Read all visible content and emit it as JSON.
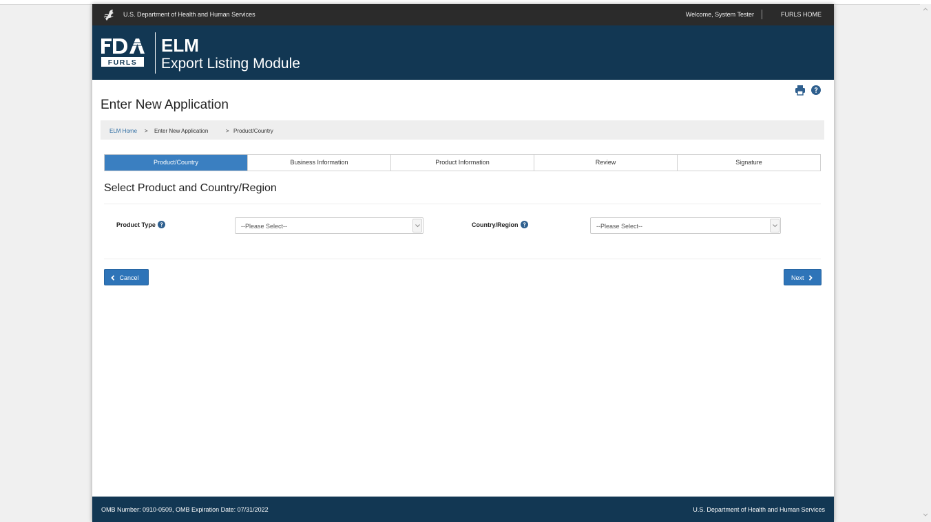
{
  "utility_bar": {
    "department": "U.S. Department of Health and Human Services",
    "welcome": "Welcome, System Tester",
    "home_link": "FURLS HOME"
  },
  "header": {
    "logo_text": "FURLS",
    "app_short": "ELM",
    "app_long": "Export Listing Module"
  },
  "page": {
    "title": "Enter New Application"
  },
  "breadcrumb": {
    "items": [
      "ELM Home",
      "Enter New Application",
      "Product/Country"
    ],
    "separator": ">"
  },
  "steps": [
    {
      "label": "Product/Country",
      "active": true
    },
    {
      "label": "Business Information",
      "active": false
    },
    {
      "label": "Product Information",
      "active": false
    },
    {
      "label": "Review",
      "active": false
    },
    {
      "label": "Signature",
      "active": false
    }
  ],
  "form": {
    "section_title": "Select Product and Country/Region",
    "product_type": {
      "label": "Product Type",
      "value": "--Please Select--"
    },
    "country_region": {
      "label": "Country/Region",
      "value": "--Please Select--"
    }
  },
  "actions": {
    "cancel": "Cancel",
    "next": "Next"
  },
  "footer": {
    "omb": "OMB Number: 0910-0509, OMB Expiration Date: 07/31/2022",
    "department": "U.S. Department of Health and Human Services"
  },
  "colors": {
    "header_bg": "#123753",
    "utility_bg": "#2b2b2b",
    "accent": "#3a7fc1",
    "button": "#2e74b8"
  },
  "icons": [
    "hhs-eagle-icon",
    "fda-logo",
    "print-icon",
    "help-icon",
    "chevron-down-icon",
    "chevron-left-icon",
    "chevron-right-icon"
  ]
}
